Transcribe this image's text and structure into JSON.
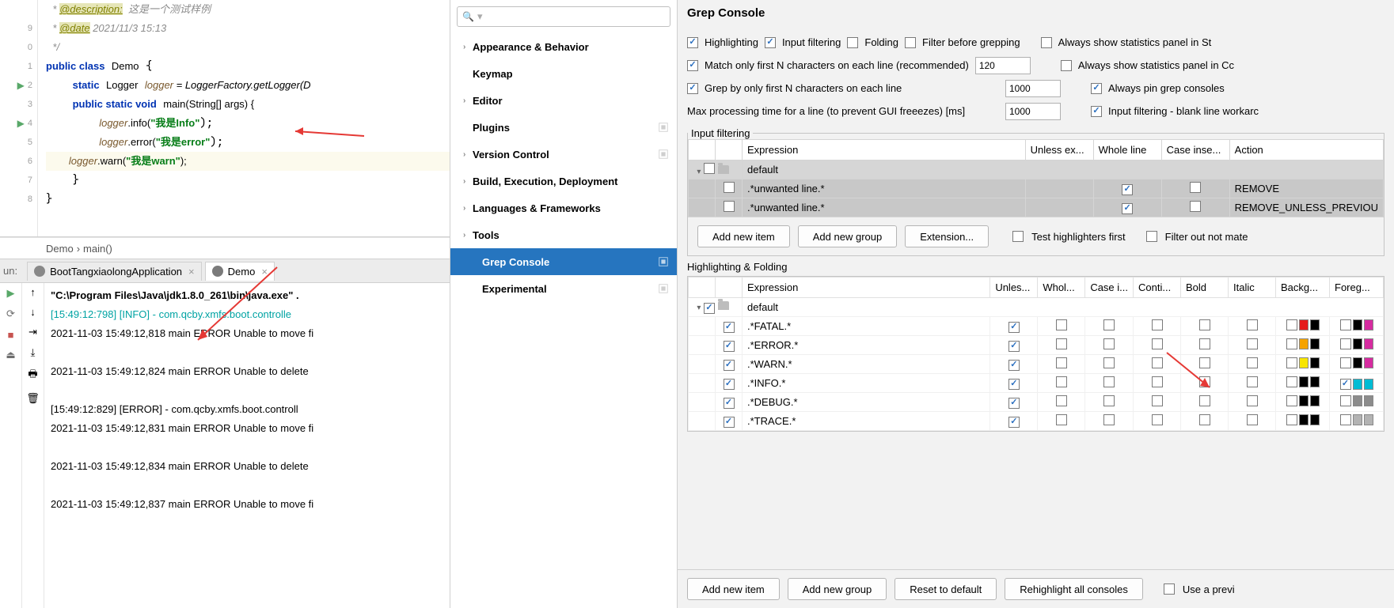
{
  "editor": {
    "lines_gutter": [
      "",
      "9",
      "0",
      "1",
      "2",
      "3",
      "4",
      "5",
      "6",
      "7",
      "8"
    ],
    "comment_desc_tag": "@description:",
    "comment_desc_text": "这是一个测试样例",
    "comment_date_tag": "@date",
    "comment_date_text": "2021/11/3 15:13",
    "class_kw": "public class",
    "class_name": "Demo",
    "logger_decl1": "static",
    "logger_type": "Logger",
    "logger_var": "logger",
    "logger_rhs": " = LoggerFactory.getLogger(D",
    "main_sig1": "public static void",
    "main_sig2": "main(String[] args) {",
    "l_info_call": ".info(",
    "l_info_str": "\"我是Info\"",
    "l_error_call": ".error(",
    "l_error_str": "\"我是error\"",
    "l_warn_call": ".warn(",
    "l_warn_str": "\"我是warn\"",
    "breadcrumb": [
      "Demo",
      "›",
      "main()"
    ]
  },
  "run": {
    "label": "un:",
    "tab1": "BootTangxiaolongApplication",
    "tab2": "Demo"
  },
  "console": {
    "l1": "\"C:\\Program Files\\Java\\jdk1.8.0_261\\bin\\java.exe\" .",
    "l2": "[15:49:12:798] [INFO] - com.qcby.xmfs.boot.controlle",
    "l3": "2021-11-03 15:49:12,818 main ERROR Unable to move fi",
    "l4": "2021-11-03 15:49:12,824 main ERROR Unable to delete",
    "l5": "[15:49:12:829] [ERROR] - com.qcby.xmfs.boot.controll",
    "l6": "2021-11-03 15:49:12,831 main ERROR Unable to move fi",
    "l7": "2021-11-03 15:49:12,834 main ERROR Unable to delete",
    "l8": "2021-11-03 15:49:12,837 main ERROR Unable to move fi"
  },
  "settings_tree": {
    "items": [
      {
        "label": "Appearance & Behavior",
        "chev": true,
        "bold": true
      },
      {
        "label": "Keymap",
        "chev": false,
        "bold": true
      },
      {
        "label": "Editor",
        "chev": true,
        "bold": true
      },
      {
        "label": "Plugins",
        "chev": false,
        "bold": true,
        "cfg": true
      },
      {
        "label": "Version Control",
        "chev": true,
        "bold": true,
        "cfg": true
      },
      {
        "label": "Build, Execution, Deployment",
        "chev": true,
        "bold": true
      },
      {
        "label": "Languages & Frameworks",
        "chev": true,
        "bold": true
      },
      {
        "label": "Tools",
        "chev": true,
        "bold": true
      },
      {
        "label": "Grep Console",
        "chev": false,
        "bold": true,
        "sel": true,
        "indent": true,
        "cfg": true
      },
      {
        "label": "Experimental",
        "chev": false,
        "bold": true,
        "indent": true,
        "cfg": true
      }
    ]
  },
  "grep": {
    "title": "Grep Console",
    "checks": {
      "highlighting": "Highlighting",
      "input_filtering": "Input filtering",
      "folding": "Folding",
      "filter_before": "Filter before grepping",
      "always_stats_st": "Always show statistics panel in St",
      "match_first_n": "Match only first N characters on each line (recommended)",
      "match_first_n_val": "120",
      "always_stats_cc": "Always show statistics panel in Cc",
      "grep_first_n": "Grep by only first N characters on each line",
      "grep_first_n_val": "1000",
      "always_pin": "Always pin grep consoles",
      "max_proc": "Max processing time for a line (to prevent GUI freeezes) [ms]",
      "max_proc_val": "1000",
      "blank_line": "Input filtering - blank line workarc"
    },
    "filter_legend": "Input filtering",
    "filter_headers": [
      "",
      "",
      "Expression",
      "Unless ex...",
      "Whole line",
      "Case inse...",
      "Action"
    ],
    "filter_rows": [
      {
        "default": true,
        "expr": "default"
      },
      {
        "expr": ".*unwanted line.*",
        "whole": true,
        "action": "REMOVE"
      },
      {
        "expr": ".*unwanted line.*",
        "whole": true,
        "action": "REMOVE_UNLESS_PREVIOU"
      }
    ],
    "buttons1": {
      "add_item": "Add new item",
      "add_group": "Add new group",
      "extension": "Extension...",
      "test_hl": "Test highlighters first",
      "filter_out": "Filter out not mate"
    },
    "hf_title": "Highlighting & Folding",
    "hf_headers": [
      "",
      "",
      "Expression",
      "Unles...",
      "Whol...",
      "Case i...",
      "Conti...",
      "Bold",
      "Italic",
      "Backg...",
      "Foreg..."
    ],
    "hf_rows": [
      {
        "default": true,
        "chk": true,
        "expr": "default"
      },
      {
        "chk": true,
        "expr": ".*FATAL.*",
        "whol": true,
        "bg1": "#e51b1b",
        "bg2": "#000",
        "fg1": "#000",
        "fg2": "#d62ba0"
      },
      {
        "chk": true,
        "expr": ".*ERROR.*",
        "whol": true,
        "bg1": "#f6a300",
        "bg2": "#000",
        "fg1": "#000",
        "fg2": "#d62ba0"
      },
      {
        "chk": true,
        "expr": ".*WARN.*",
        "whol": true,
        "bg1": "#f8e500",
        "bg2": "#000",
        "fg1": "#000",
        "fg2": "#d62ba0"
      },
      {
        "chk": true,
        "expr": ".*INFO.*",
        "whol": true,
        "bg1": "#000",
        "bg2": "#000",
        "fg1": "#00bcd4",
        "fg2": "#00bcd4",
        "fgchk": true
      },
      {
        "chk": true,
        "expr": ".*DEBUG.*",
        "whol": true,
        "bg1": "#000",
        "bg2": "#000",
        "fg1": "#8c8c8c",
        "fg2": "#8c8c8c"
      },
      {
        "chk": true,
        "expr": ".*TRACE.*",
        "whol": true,
        "bg1": "#000",
        "bg2": "#000",
        "fg1": "#b3b3b3",
        "fg2": "#b3b3b3"
      }
    ],
    "buttons2": {
      "add_item": "Add new item",
      "add_group": "Add new group",
      "reset": "Reset to default",
      "rehl": "Rehighlight all consoles",
      "use_prev": "Use a previ"
    }
  }
}
